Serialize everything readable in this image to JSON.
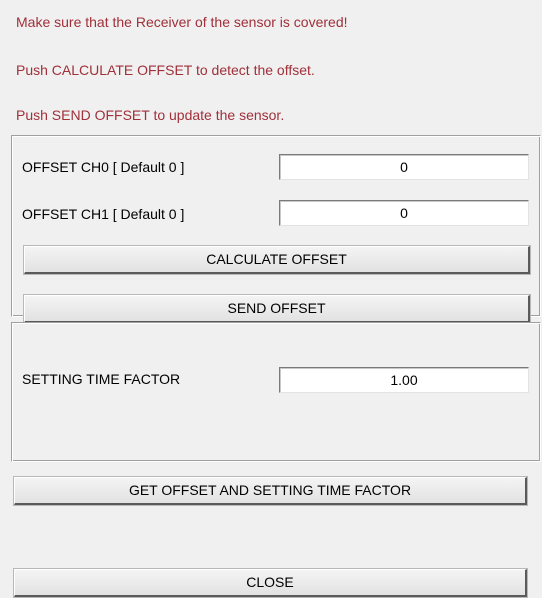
{
  "messages": {
    "line1": "Make sure that the Receiver of the sensor is covered!",
    "line2": "Push CALCULATE OFFSET to detect the offset.",
    "line3": "Push SEND OFFSET to update the sensor."
  },
  "offset_panel": {
    "ch0_label": "OFFSET CH0 [ Default 0 ]",
    "ch0_value": "0",
    "ch1_label": "OFFSET CH1 [ Default 0 ]",
    "ch1_value": "0",
    "calculate_label": "CALCULATE OFFSET",
    "send_label": "SEND OFFSET"
  },
  "time_panel": {
    "label": "SETTING TIME FACTOR",
    "value": "1.00"
  },
  "buttons": {
    "get_label": "GET OFFSET AND SETTING TIME FACTOR",
    "close_label": "CLOSE"
  },
  "colors": {
    "message_text": "#a0303a",
    "background": "#f0f0f0"
  }
}
